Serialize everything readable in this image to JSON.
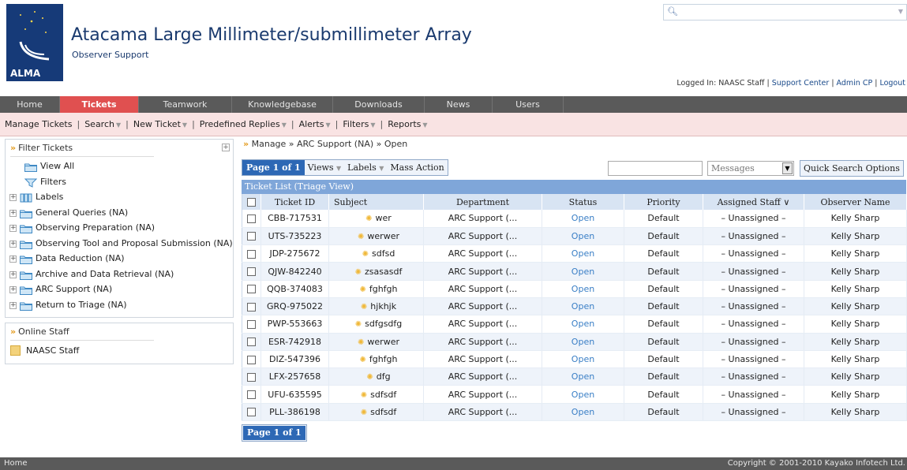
{
  "header": {
    "logo_text": "ALMA",
    "title": "Atacama Large Millimeter/submillimeter Array",
    "subtitle": "Observer Support",
    "search_placeholder": "",
    "logged_in_prefix": "Logged In: NAASC Staff |",
    "links": [
      "Support Center",
      "Admin CP",
      "Logout"
    ]
  },
  "tabs": [
    {
      "label": "Home",
      "active": false
    },
    {
      "label": "Tickets",
      "active": true
    },
    {
      "label": "Teamwork",
      "active": false
    },
    {
      "label": "Knowledgebase",
      "active": false
    },
    {
      "label": "Downloads",
      "active": false
    },
    {
      "label": "News",
      "active": false
    },
    {
      "label": "Users",
      "active": false
    }
  ],
  "subnav": [
    "Manage Tickets",
    "Search",
    "New Ticket",
    "Predefined Replies",
    "Alerts",
    "Filters",
    "Reports"
  ],
  "sidebar": {
    "filter_title": "Filter Tickets",
    "tree": [
      {
        "label": "View All",
        "icon": "folder-icon",
        "plus": false
      },
      {
        "label": "Filters",
        "icon": "funnel-icon",
        "plus": false
      },
      {
        "label": "Labels",
        "icon": "labels-icon",
        "plus": true
      },
      {
        "label": "General Queries (NA)",
        "icon": "folder-icon",
        "plus": true
      },
      {
        "label": "Observing Preparation (NA)",
        "icon": "folder-icon",
        "plus": true
      },
      {
        "label": "Observing Tool and Proposal Submission (NA)",
        "icon": "folder-icon",
        "plus": true
      },
      {
        "label": "Data Reduction (NA)",
        "icon": "folder-icon",
        "plus": true
      },
      {
        "label": "Archive and Data Retrieval (NA)",
        "icon": "folder-icon",
        "plus": true
      },
      {
        "label": "ARC Support (NA)",
        "icon": "folder-icon",
        "plus": true
      },
      {
        "label": "Return to Triage (NA)",
        "icon": "folder-icon",
        "plus": true
      }
    ],
    "online_title": "Online Staff",
    "online_staff": [
      "NAASC Staff"
    ]
  },
  "main": {
    "breadcrumb": "Manage » ARC Support (NA) » Open",
    "pager": "Page 1 of 1",
    "views_label": "Views",
    "labels_label": "Labels",
    "mass_action_label": "Mass Action",
    "search_select_value": "Messages",
    "quick_search_label": "Quick Search",
    "options_label": "Options",
    "list_title": "Ticket List (Triage View)",
    "columns": [
      "Ticket ID",
      "Subject",
      "Department",
      "Status",
      "Priority",
      "Assigned Staff",
      "Observer Name"
    ],
    "rows": [
      [
        "CBB-717531",
        "wer",
        "ARC Support (...",
        "Open",
        "Default",
        "– Unassigned –",
        "Kelly Sharp"
      ],
      [
        "UTS-735223",
        "werwer",
        "ARC Support (...",
        "Open",
        "Default",
        "– Unassigned –",
        "Kelly Sharp"
      ],
      [
        "JDP-275672",
        "sdfsd",
        "ARC Support (...",
        "Open",
        "Default",
        "– Unassigned –",
        "Kelly Sharp"
      ],
      [
        "QJW-842240",
        "zsasasdf",
        "ARC Support (...",
        "Open",
        "Default",
        "– Unassigned –",
        "Kelly Sharp"
      ],
      [
        "QQB-374083",
        "fghfgh",
        "ARC Support (...",
        "Open",
        "Default",
        "– Unassigned –",
        "Kelly Sharp"
      ],
      [
        "GRQ-975022",
        "hjkhjk",
        "ARC Support (...",
        "Open",
        "Default",
        "– Unassigned –",
        "Kelly Sharp"
      ],
      [
        "PWP-553663",
        "sdfgsdfg",
        "ARC Support (...",
        "Open",
        "Default",
        "– Unassigned –",
        "Kelly Sharp"
      ],
      [
        "ESR-742918",
        "werwer",
        "ARC Support (...",
        "Open",
        "Default",
        "– Unassigned –",
        "Kelly Sharp"
      ],
      [
        "DIZ-547396",
        "fghfgh",
        "ARC Support (...",
        "Open",
        "Default",
        "– Unassigned –",
        "Kelly Sharp"
      ],
      [
        "LFX-257658",
        "dfg",
        "ARC Support (...",
        "Open",
        "Default",
        "– Unassigned –",
        "Kelly Sharp"
      ],
      [
        "UFU-635595",
        "sdfsdf",
        "ARC Support (...",
        "Open",
        "Default",
        "– Unassigned –",
        "Kelly Sharp"
      ],
      [
        "PLL-386198",
        "sdfsdf",
        "ARC Support (...",
        "Open",
        "Default",
        "– Unassigned –",
        "Kelly Sharp"
      ]
    ]
  },
  "footer": {
    "left": "Home",
    "right": "Copyright © 2001-2010 Kayako Infotech Ltd."
  },
  "colors": {
    "brand_blue": "#1a3a6e",
    "active_tab": "#e05050",
    "tab_bar": "#5a5a5a",
    "list_header": "#7fa6d9",
    "status_link": "#3a7fc6",
    "subnav_bg": "#f9e3e3"
  }
}
